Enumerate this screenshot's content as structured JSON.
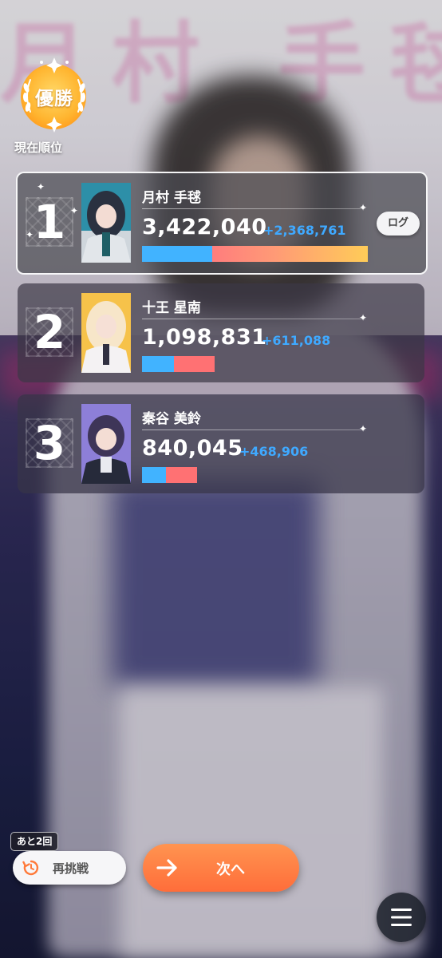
{
  "header": {
    "medal_label": "優勝",
    "rank_caption": "現在順位"
  },
  "ranking": [
    {
      "rank": "1",
      "name": "月村 手毬",
      "score": "3,422,040",
      "delta": "+2,368,761",
      "bar_total_fraction": 0.9,
      "bar_base_fraction": 0.31,
      "avatar_color": "#2d8fa8"
    },
    {
      "rank": "2",
      "name": "十王 星南",
      "score": "1,098,831",
      "delta": "+611,088",
      "bar_total_fraction": 0.29,
      "bar_base_fraction": 0.44,
      "avatar_color": "#f6c24a"
    },
    {
      "rank": "3",
      "name": "秦谷 美鈴",
      "score": "840,045",
      "delta": "+468,906",
      "bar_total_fraction": 0.22,
      "bar_base_fraction": 0.44,
      "avatar_color": "#8d7fd8"
    }
  ],
  "log_button_label": "ログ",
  "controls": {
    "remaining_label": "あと2回",
    "retry_label": "再挑戦",
    "next_label": "次へ"
  },
  "colors": {
    "accent_orange": "#ff7a40",
    "delta_blue": "#3fa9ff",
    "bar_blue": "#41b3ff",
    "bar_red": "#ff7173"
  },
  "icons": [
    "laurel-icon",
    "sparkle-icon",
    "log-icon",
    "retry-icon",
    "arrow-right-icon",
    "menu-icon"
  ]
}
